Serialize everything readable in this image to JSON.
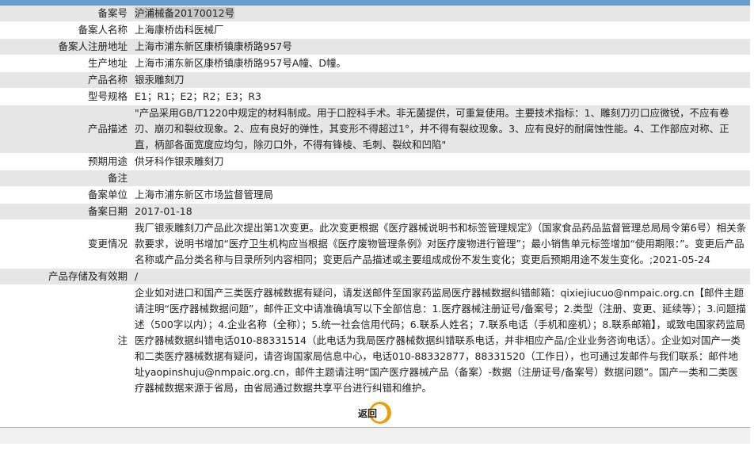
{
  "rows": [
    {
      "label": "备案号",
      "value": "沪浦械备20170012号"
    },
    {
      "label": "备案人名称",
      "value": "上海康桥齿科医械厂"
    },
    {
      "label": "备案人注册地址",
      "value": "上海市浦东新区康桥镇康桥路957号"
    },
    {
      "label": "生产地址",
      "value": "上海市浦东新区康桥镇康桥路957号A幢、D幢。"
    },
    {
      "label": "产品名称",
      "value": "银汞雕刻刀"
    },
    {
      "label": "型号规格",
      "value": "E1；R1；E2；R2；E3；R3"
    },
    {
      "label": "产品描述",
      "value": "\"产品采用GB/T1220中规定的材料制成。用于口腔科手术。非无菌提供，可重复使用。主要技术指标：1、雕刻刀刃口应微锐，不应有卷刃、崩刃和裂纹现象。2、应有良好的弹性，其变形不得超过1°，并不得有裂纹现象。3、应有良好的耐腐蚀性能。4、工作部应对称、正直，柄部各面宽度应均匀，除刃口外，不得有锋棱、毛刺、裂纹和凹陷\""
    },
    {
      "label": "预期用途",
      "value": "供牙科作银汞雕刻刀"
    },
    {
      "label": "备注",
      "value": ""
    },
    {
      "label": "备案单位",
      "value": "上海市浦东新区市场监督管理局"
    },
    {
      "label": "备案日期",
      "value": "2017-01-18"
    },
    {
      "label": "变更情况",
      "value": "我厂银汞雕刻刀产品此次提出第1次变更。此次变更根据《医疗器械说明书和标签管理规定》（国家食品药品监督管理总局局令第6号）相关条款要求，说明书增加“医疗卫生机构应当根据《医疗废物管理条例》对医疗废物进行管理”；最小销售单元标签增加“使用期限：”。变更后产品名称或产品分类名称与目录所列内容相同；变更后产品描述或主要组成成份不发生变化；变更后预期用途不发生变化。;2021-05-24"
    },
    {
      "label": "产品存储及有效期",
      "value": "/"
    },
    {
      "label": "注",
      "value": "企业如对进口和国产三类医疗器械数据有疑问，请发送邮件至国家药监局医疗器械数据纠错邮箱：qixiejiucuo@nmpaic.org.cn【邮件主题请注明“医疗器械数据问题”，邮件正文中请准确填写以下全部信息：1.医疗器械注册证号/备案号；2.类型（注册、变更、延续等）；3.问题描述（500字以内）；4.企业名称（全称）；5.统一社会信用代码；6.联系人姓名；7.联系电话（手机和座机）；8.联系邮箱】，或致电国家药监局医疗器械数据纠错电话010-88331514（此电话为我局医疗器械数据纠错联系电话，并非相应产品/企业业务咨询电话）。企业如对国产一类和二类医疗器械数据有疑问，请咨询国家局信息中心，电话010-88332877，88331520（工作日），也可通过发邮件与我们联系：邮件地址yaopinshuju@nmpaic.org.cn，邮件主题请注明“国产医疗器械产品（备案）-数据（注册证号/备案号）数据问题”。国产一类和二类医疗器械数据来源于省局，由省局通过数据共享平台进行纠错和维护。"
    }
  ],
  "back_label": "返回"
}
